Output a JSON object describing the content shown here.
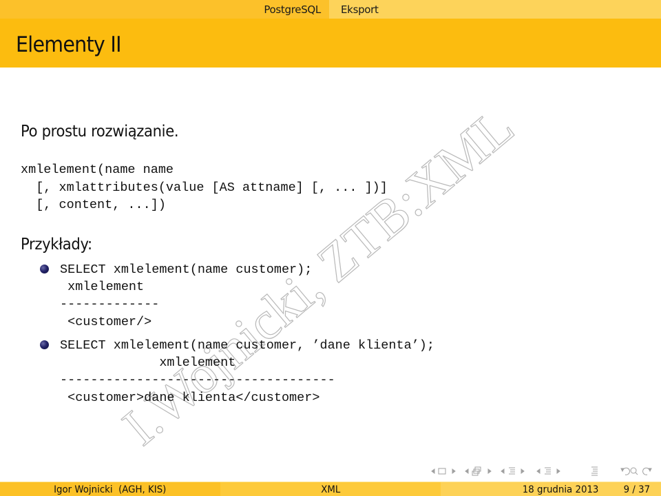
{
  "topnav": {
    "sections": [
      "PostgreSQL",
      "Eksport"
    ]
  },
  "slide": {
    "title": "Elementy II",
    "intro": "Po prostu rozwiązanie.",
    "syntax": [
      "xmlelement(name name",
      "  [, xmlattributes(value [AS attname] [, ... ])]",
      "  [, content, ...])"
    ],
    "examples_heading": "Przykłady:",
    "examples": [
      {
        "query": "SELECT xmlelement(name customer);",
        "output": [
          " xmlelement",
          "-------------",
          " <customer/>"
        ]
      },
      {
        "query": "SELECT xmlelement(name customer, ’dane klienta’);",
        "output": [
          "             xmlelement",
          "------------------------------------",
          " <customer>dane klienta</customer>"
        ]
      }
    ],
    "watermark": "I.Wojnicki, ZTB:XML"
  },
  "navigation": {
    "icons": [
      "nav-frame-left",
      "nav-frame",
      "nav-frame-right",
      "nav-subsection-left",
      "nav-subsection",
      "nav-subsection-right",
      "nav-section-left",
      "nav-section",
      "nav-section-right",
      "nav-part-left",
      "nav-part",
      "nav-part-right",
      "nav-toc",
      "nav-back",
      "nav-search",
      "nav-forward"
    ]
  },
  "footer": {
    "author": "Igor Wojnicki  (AGH, KIS)",
    "title": "XML",
    "date": "18 grudnia 2013",
    "page": "9 / 37"
  },
  "colors": {
    "nav_dark": "#fcc12a",
    "nav_light": "#fdd35a",
    "title_bar": "#fcbc0f",
    "bullet": "#24246a"
  }
}
